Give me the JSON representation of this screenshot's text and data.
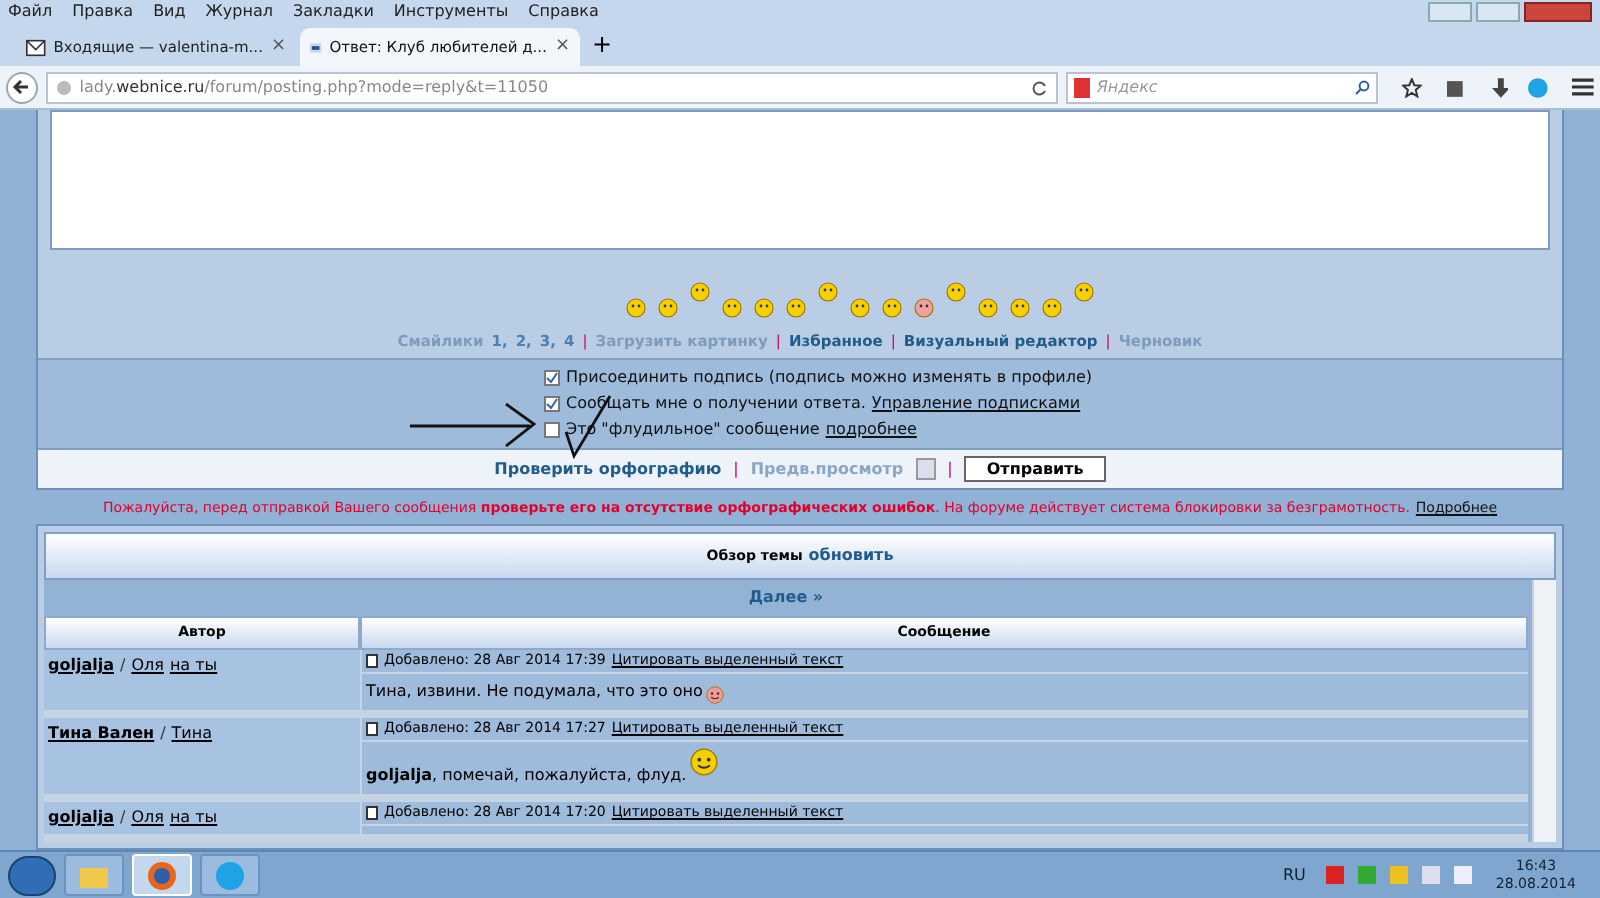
{
  "menu": [
    "Файл",
    "Правка",
    "Вид",
    "Журнал",
    "Закладки",
    "Инструменты",
    "Справка"
  ],
  "tabs": [
    {
      "label": "Входящие — valentina-m...",
      "selected": false,
      "close": "×"
    },
    {
      "label": "Ответ: Клуб любителей д...",
      "selected": true,
      "close": "×"
    }
  ],
  "new_tab": "+",
  "address": {
    "url_start": "lady.",
    "url_domain": "webnice.ru",
    "url_rest": "/forum/posting.php?mode=reply&t=11050"
  },
  "search": {
    "placeholder": "Яндекс"
  },
  "links": [
    {
      "label": "Смайлики",
      "kind": "muted"
    },
    {
      "label": "1,",
      "kind": "num"
    },
    {
      "label": "2,",
      "kind": "num"
    },
    {
      "label": "3,",
      "kind": "num"
    },
    {
      "label": "4",
      "kind": "num"
    },
    {
      "label": "|",
      "kind": "sep"
    },
    {
      "label": "Загрузить картинку",
      "kind": "muted"
    },
    {
      "label": "|",
      "kind": "sep"
    },
    {
      "label": "Избранное",
      "kind": "bold"
    },
    {
      "label": "|",
      "kind": "sep"
    },
    {
      "label": "Визуальный редактор",
      "kind": "bold"
    },
    {
      "label": "|",
      "kind": "sep"
    },
    {
      "label": "Черновик",
      "kind": "muted"
    }
  ],
  "options": [
    {
      "text": "Присоединить подпись (подпись можно изменять в профиле)",
      "checked": true
    },
    {
      "text": "Сообщать мне о получении ответа.",
      "link": "Управление подписками",
      "checked": true
    },
    {
      "text": "Это \"флудильное\" сообщение",
      "link": "подробнее",
      "checked": false
    }
  ],
  "actions": [
    {
      "label": "Проверить орфографию",
      "kind": "bold"
    },
    {
      "label": "|",
      "kind": "sep"
    },
    {
      "label": "Предв.просмотр",
      "kind": "muted"
    },
    {
      "kind": "icon"
    },
    {
      "label": "|",
      "kind": "sep"
    },
    {
      "label": "Отправить",
      "kind": "button"
    }
  ],
  "warning": {
    "text": "Пожалуйста, перед отправкой Вашего сообщения **проверьте его на отсутствие орфографических ошибок**. На форуме действует система блокировки за безграмотность.",
    "link": "Подробнее"
  },
  "review": {
    "title": "Обзор темы",
    "refresh": "обновить",
    "next": "Далее »",
    "columns": [
      "Автор",
      "Сообщение"
    ],
    "posts": [
      {
        "author": "goljalja",
        "sep": "/",
        "alias": "Оля",
        "extra": "на ты",
        "date": "Добавлено: 28 Авг 2014 17:39",
        "quote": "Цитировать выделенный текст",
        "message": "Тина, извини. Не подумала, что это оно",
        "kind": "inline-smiley"
      },
      {
        "author": "Тина Вален",
        "sep": "/",
        "alias": "Тина",
        "date": "Добавлено: 28 Авг 2014 17:27",
        "quote": "Цитировать выделенный текст",
        "message": "**goljalja**, помечай, пожалуйста, флуд.",
        "kind": "raised-smiley"
      },
      {
        "author": "goljalja",
        "sep": "/",
        "alias": "Оля",
        "extra": "на ты",
        "date": "Добавлено: 28 Авг 2014 17:20",
        "quote": "Цитировать выделенный текст"
      }
    ]
  },
  "taskbar": {
    "apps": [
      {
        "kind": "folder",
        "selected": false
      },
      {
        "kind": "browser",
        "selected": true
      },
      {
        "kind": "chat",
        "selected": false
      }
    ],
    "lang": "RU",
    "time": "16:43",
    "date": "28.08.2014"
  }
}
